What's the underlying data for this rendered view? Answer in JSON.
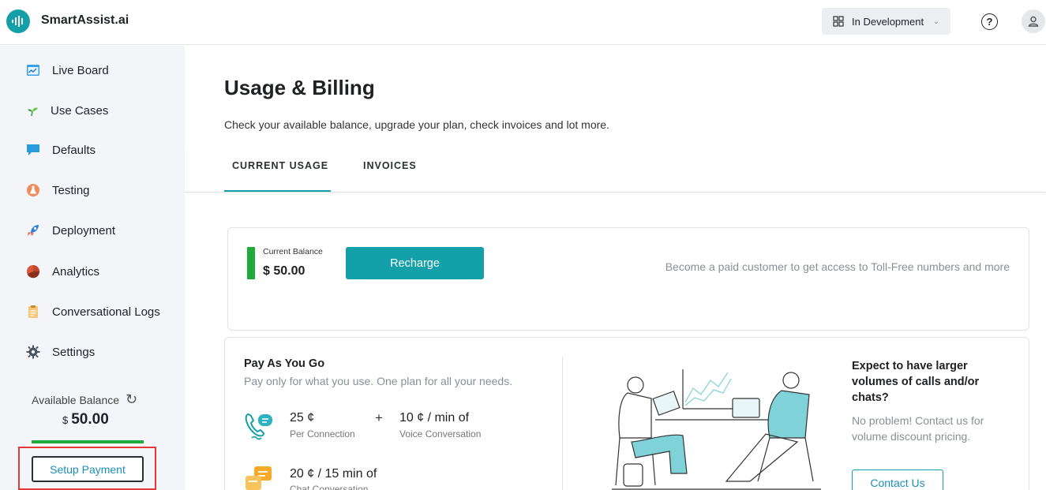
{
  "app": {
    "title": "SmartAssist.ai"
  },
  "header": {
    "environment": "In Development"
  },
  "sidebar": {
    "items": [
      {
        "label": "Live Board",
        "icon": "live-board-icon"
      },
      {
        "label": "Use Cases",
        "icon": "sprout-icon"
      },
      {
        "label": "Defaults",
        "icon": "chat-bubble-icon"
      },
      {
        "label": "Testing",
        "icon": "flask-icon"
      },
      {
        "label": "Deployment",
        "icon": "rocket-icon"
      },
      {
        "label": "Analytics",
        "icon": "analytics-icon"
      },
      {
        "label": "Conversational Logs",
        "icon": "clipboard-icon"
      },
      {
        "label": "Settings",
        "icon": "gear-icon"
      }
    ],
    "balance_label": "Available Balance",
    "balance_currency": "$",
    "balance_amount": "50.00",
    "setup_payment": "Setup Payment"
  },
  "main": {
    "title": "Usage & Billing",
    "subtitle": "Check your available balance, upgrade your plan, check invoices and lot more.",
    "tabs": [
      {
        "label": "CURRENT USAGE",
        "active": true
      },
      {
        "label": "INVOICES",
        "active": false
      }
    ],
    "balance_card": {
      "label": "Current Balance",
      "value": "$ 50.00",
      "recharge": "Recharge",
      "promo": "Become a paid customer to get access to Toll-Free numbers and more"
    },
    "payg": {
      "title": "Pay As You Go",
      "subtitle": "Pay only for what you use. One plan for all your needs.",
      "rates": [
        {
          "value": "25 ¢",
          "desc": "Per Connection"
        },
        {
          "value": "10 ¢ / min of",
          "desc": "Voice Conversation"
        },
        {
          "value": "20 ¢ / 15 min of",
          "desc": "Chat Conversation"
        }
      ],
      "plus": "+"
    },
    "enterprise": {
      "title": "Expect to have larger volumes of calls and/or chats?",
      "subtitle": "No problem! Contact us for volume discount pricing.",
      "contact": "Contact Us"
    }
  },
  "colors": {
    "accent": "#13a0a8",
    "balance_green": "#1faa3b",
    "highlight_red": "#e53935"
  }
}
